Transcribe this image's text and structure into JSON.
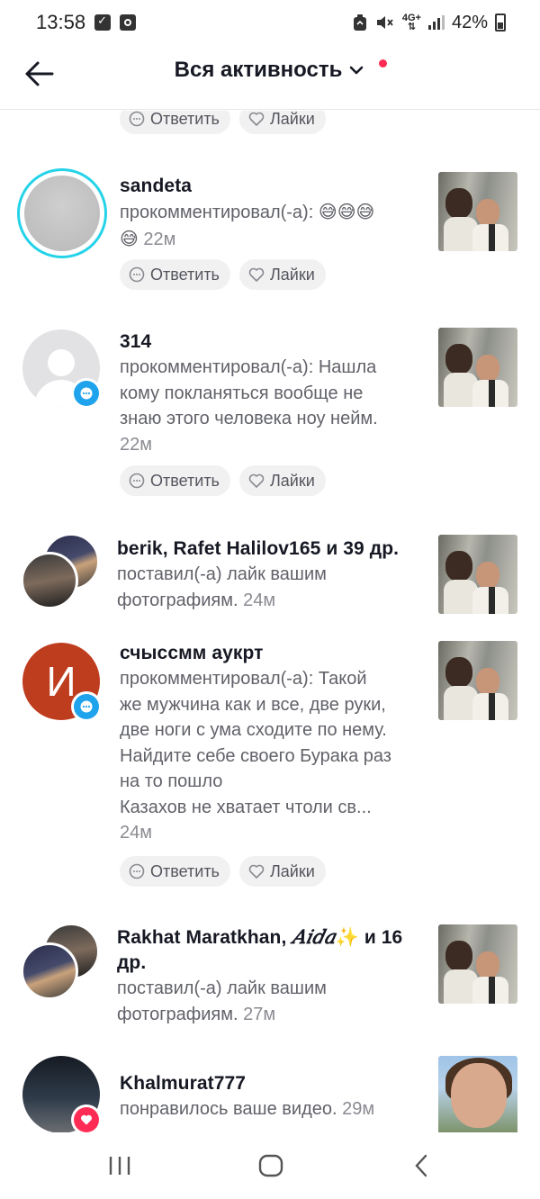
{
  "status_bar": {
    "time": "13:58",
    "network": "4G+",
    "battery": "42%",
    "icons": [
      "checkbox-icon",
      "camera-icon",
      "recycle-icon",
      "mute-icon",
      "signal-icon",
      "battery-icon"
    ]
  },
  "header": {
    "title": "Вся активность"
  },
  "actions": {
    "reply": "Ответить",
    "like": "Лайки"
  },
  "items": [
    {
      "username": "sandeta",
      "text": "прокомментировал(-а):",
      "emojis": "😅😅😅",
      "emoji_tail": "😅",
      "time": "22м"
    },
    {
      "username": "314",
      "lines": [
        "прокомментировал(-а): Нашла",
        "кому покланяться вообще не",
        "знаю этого человека ноу нейм."
      ],
      "time": "22м"
    },
    {
      "username": "berik, Rafet Halilov165 и 39 др.",
      "lines": [
        "поставил(-а) лайк вашим"
      ],
      "tail": "фотографиям.",
      "time": "24м"
    },
    {
      "username": "счыссмм аукрт",
      "avatar_letter": "И",
      "lines": [
        "прокомментировал(-а): Такой",
        "же мужчина как и все, две руки,",
        "две ноги с ума сходите по нему.",
        "Найдите себе своего Бурака раз",
        "на то пошло",
        "Казахов не хватает чтоли св..."
      ],
      "time": "24м"
    },
    {
      "username_a": "Rakhat Maratkhan,",
      "username_b": "𝐴𝑖𝑑𝑎",
      "username_sparkle": "✨",
      "username_c": "и 16",
      "username_d": "др.",
      "lines": [
        "поставил(-а) лайк вашим"
      ],
      "tail": "фотографиям.",
      "time": "27м"
    },
    {
      "username": "Khalmurat777",
      "text": "понравилось ваше видео.",
      "time": "29м"
    }
  ]
}
